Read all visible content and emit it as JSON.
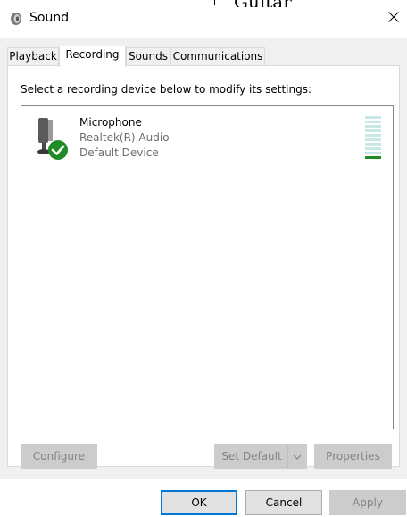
{
  "window": {
    "title": "Sound",
    "top_artifact_text": "Guitar"
  },
  "tabs": [
    {
      "label": "Playback",
      "active": false
    },
    {
      "label": "Recording",
      "active": true
    },
    {
      "label": "Sounds",
      "active": false
    },
    {
      "label": "Communications",
      "active": false
    }
  ],
  "recording": {
    "instruction": "Select a recording device below to modify its settings:",
    "devices": [
      {
        "name": "Microphone",
        "driver": "Realtek(R) Audio",
        "status": "Default Device",
        "level_bars_total": 10,
        "level_bars_on": 1
      }
    ],
    "buttons": {
      "configure": "Configure",
      "set_default": "Set Default",
      "properties": "Properties"
    }
  },
  "footer": {
    "ok": "OK",
    "cancel": "Cancel",
    "apply": "Apply"
  },
  "colors": {
    "accent": "#0078d7",
    "check_green": "#1f8b24",
    "level_off": "#c9e7e6",
    "disabled_text": "#838383"
  },
  "icons": {
    "title": "speaker-icon",
    "close": "close-icon",
    "device": "microphone-icon",
    "default_badge": "checkmark-badge-icon",
    "split": "chevron-down-icon"
  }
}
